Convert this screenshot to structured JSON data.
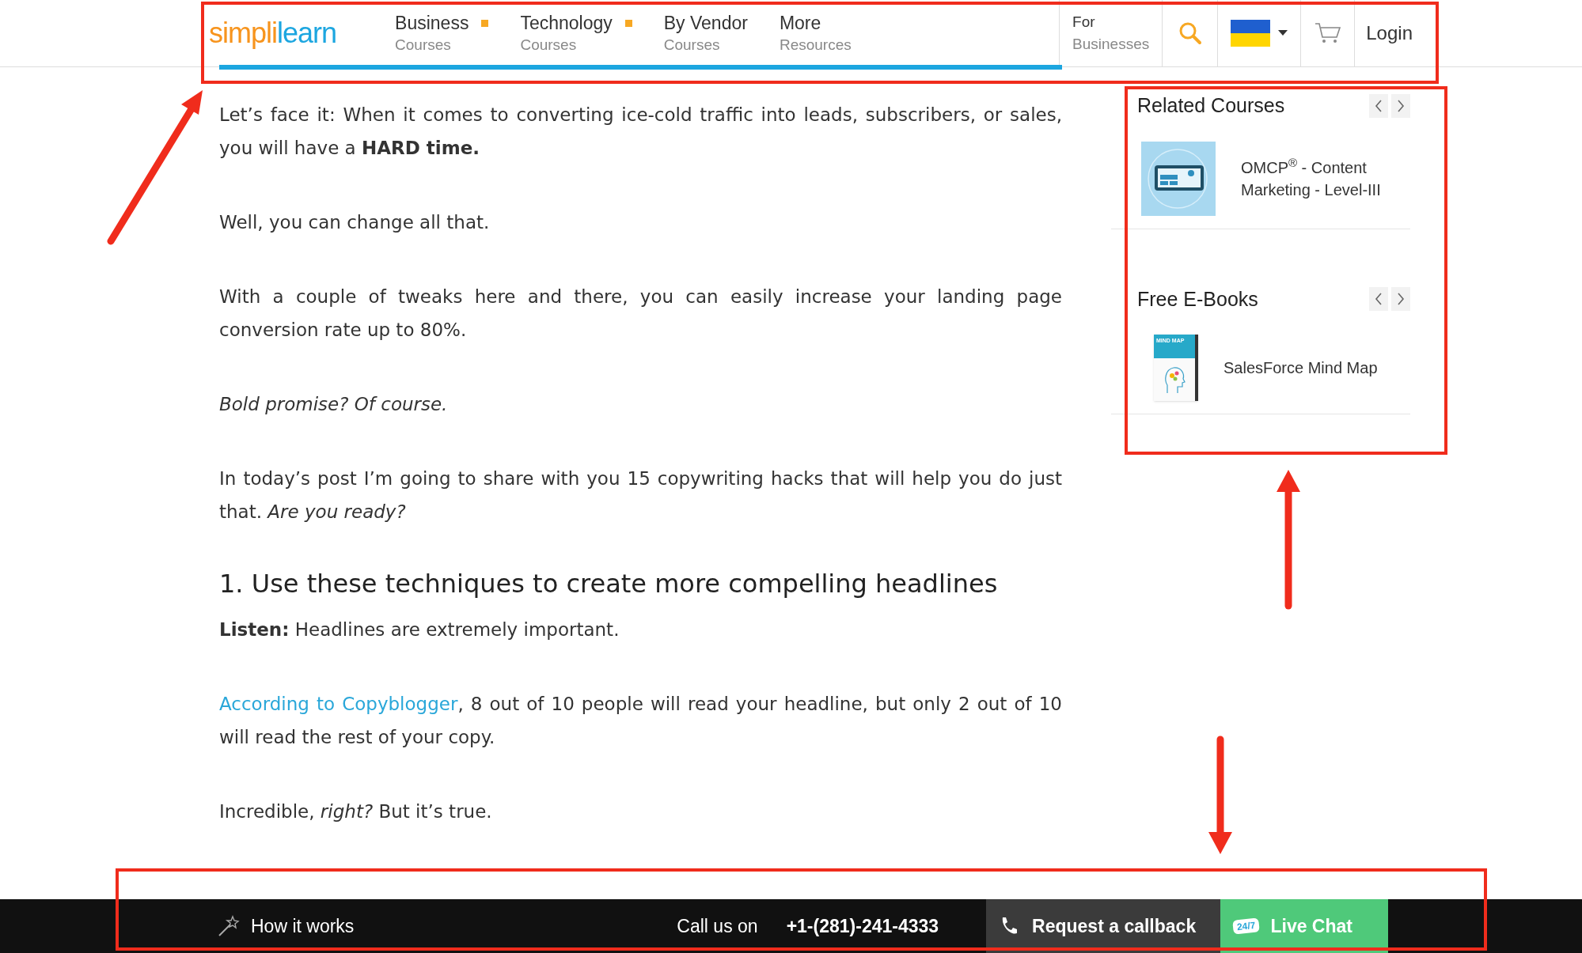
{
  "header": {
    "logo": [
      {
        "text": "simpl",
        "color": "#f7941d"
      },
      {
        "text": "i",
        "color": "#f7941d"
      },
      {
        "text": "learn",
        "color": "#1ca6e0"
      }
    ],
    "nav": [
      {
        "title": "Business",
        "subtitle": "Courses",
        "dot": true
      },
      {
        "title": "Technology",
        "subtitle": "Courses",
        "dot": true
      },
      {
        "title": "By Vendor",
        "subtitle": "Courses",
        "dot": false
      },
      {
        "title": "More",
        "subtitle": "Resources",
        "dot": false
      }
    ],
    "for_businesses": {
      "line1": "For",
      "line2": "Businesses"
    },
    "login": "Login"
  },
  "article": {
    "blocks": [
      {
        "kind": "p",
        "text": "Let’s face it: When it comes to converting ice-cold traffic into leads, subscribers, or sales, you will have a **HARD time.**"
      },
      {
        "kind": "p",
        "text": "Well, you can change all that."
      },
      {
        "kind": "p",
        "text": "With a couple of tweaks here and there, you can easily increase your landing page conversion rate up to 80%."
      },
      {
        "kind": "italic",
        "text": "Bold promise? Of course."
      },
      {
        "kind": "p",
        "text": "In today’s post I’m going to share with you 15 copywriting hacks that will help you do just that. *Are you ready?*"
      },
      {
        "kind": "heading",
        "text": "1. Use these techniques to create more compelling headlines"
      },
      {
        "kind": "tight",
        "text": "**Listen:** Headlines are extremely important."
      },
      {
        "kind": "link_p",
        "link": "According to Copyblogger",
        "text": ", 8 out of 10 people will read your headline, but only 2 out of 10 will read the rest of your copy."
      },
      {
        "kind": "p",
        "text": "Incredible, *right?* But it’s true."
      }
    ]
  },
  "sidebar": [
    {
      "title": "Related Courses",
      "items": [
        {
          "kind": "course",
          "title": "OMCP$^{®}$ - Content Marketing - Level-III"
        }
      ]
    },
    {
      "title": "Free E-Books",
      "items": [
        {
          "kind": "ebook",
          "title": "SalesForce Mind Map",
          "cover_title": "MIND MAP"
        }
      ]
    }
  ],
  "footer": {
    "how_it_works": "How it works",
    "call_label": "Call us on",
    "phone": "+1-(281)-241-4333",
    "callback": "Request a callback",
    "chat_badge": "24/7",
    "live_chat": "Live Chat"
  }
}
